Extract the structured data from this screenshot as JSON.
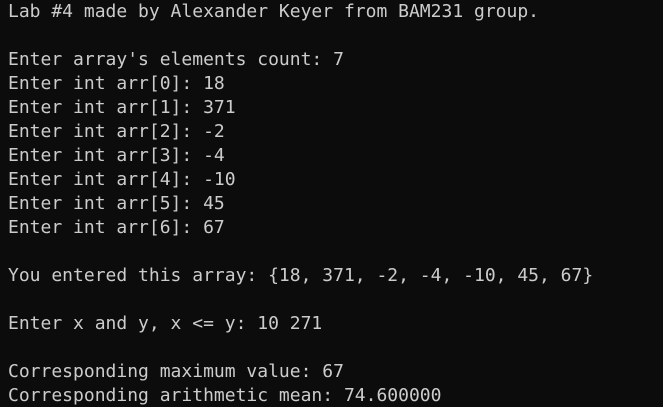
{
  "terminal": {
    "background": "#0c0c0c",
    "foreground": "#cccccc",
    "lines": [
      "Lab #4 made by Alexander Keyer from BAM231 group.",
      "",
      "Enter array's elements count: 7",
      "Enter int arr[0]: 18",
      "Enter int arr[1]: 371",
      "Enter int arr[2]: -2",
      "Enter int arr[3]: -4",
      "Enter int arr[4]: -10",
      "Enter int arr[5]: 45",
      "Enter int arr[6]: 67",
      "",
      "You entered this array: {18, 371, -2, -4, -10, 45, 67}",
      "",
      "Enter x and y, x <= y: 10 271",
      "",
      "Corresponding maximum value: 67",
      "Corresponding arithmetic mean: 74.600000"
    ]
  }
}
